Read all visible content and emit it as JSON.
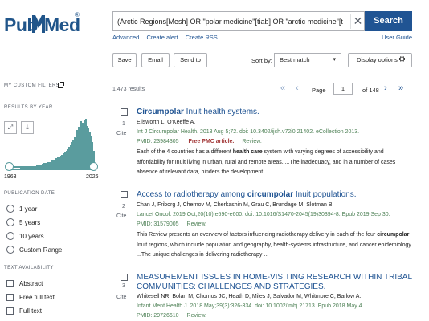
{
  "header": {
    "logo_pub": "Pub",
    "logo_med": "Med",
    "logo_reg": "®",
    "search_value": "(Arctic Regions[Mesh] OR \"polar medicine\"[tiab] OR \"arctic medicine\"[tiab] O",
    "search_button": "Search",
    "clear_symbol": "✕",
    "links": [
      "Advanced",
      "Create alert",
      "Create RSS"
    ],
    "user_guide": "User Guide"
  },
  "toolbar": {
    "save": "Save",
    "email": "Email",
    "send_to": "Send to",
    "sort_label": "Sort by:",
    "sort_value": "Best match",
    "display_options": "Display options"
  },
  "sidebar": {
    "custom_filters": "MY CUSTOM FILTERS",
    "results_by_year": "RESULTS BY YEAR",
    "year_start": "1963",
    "year_end": "2026",
    "publication_date": "PUBLICATION DATE",
    "date_options": [
      "1 year",
      "5 years",
      "10 years",
      "Custom Range"
    ],
    "text_availability": "TEXT AVAILABILITY",
    "text_options": [
      "Abstract",
      "Free full text",
      "Full text"
    ],
    "histogram": [
      1,
      1,
      1,
      1,
      2,
      2,
      2,
      2,
      3,
      3,
      3,
      3,
      4,
      4,
      4,
      5,
      5,
      5,
      6,
      6,
      7,
      7,
      8,
      8,
      9,
      10,
      10,
      11,
      12,
      12,
      13,
      14,
      15,
      16,
      17,
      18,
      19,
      20,
      22,
      24,
      26,
      28,
      30,
      33,
      36,
      40,
      44,
      48,
      52,
      58,
      62,
      66,
      70,
      68,
      72,
      74,
      64,
      60,
      56,
      50,
      40,
      28
    ]
  },
  "results": {
    "count": "1,473 results",
    "page_label": "Page",
    "page_value": "1",
    "page_of": "of 148",
    "items": [
      {
        "num": "1",
        "cite": "Cite",
        "title_bold": "Circumpolar",
        "title_rest": " Inuit health systems.",
        "authors": "Ellsworth L, O'Keeffe A.",
        "journal": "Int J Circumpolar Health. 2013 Aug 5;72. doi: 10.3402/ijch.v72i0.21402. eCollection 2013.",
        "pmid": "PMID: 23984305",
        "free": "Free PMC article.",
        "review": "Review.",
        "snippet_a": "Each of the 4 countries has a different ",
        "snippet_bold": "health care",
        "snippet_b": " system with varying degrees of accessibility and affordability for Inuit living in urban, rural and remote areas. ...The inadequacy, and in a number of cases absence of relevant data, hinders the development ..."
      },
      {
        "num": "2",
        "cite": "Cite",
        "title_pre": "Access to radiotherapy among ",
        "title_bold": "circumpolar",
        "title_rest": " Inuit populations.",
        "authors": "Chan J, Friborg J, Chernov M, Cherkashin M, Grau C, Brundage M, Slotman B.",
        "journal": "Lancet Oncol. 2019 Oct;20(10):e590-e600. doi: 10.1016/S1470-2045(19)30394-8. Epub 2019 Sep 30.",
        "pmid": "PMID: 31579005",
        "review": "Review.",
        "snippet_a": "This Review presents an overview of factors influencing radiotherapy delivery in each of the four ",
        "snippet_bold": "circumpolar",
        "snippet_b": " Inuit regions, which include population and geography, health-systems infrastructure, and cancer epidemiology. ...The unique challenges in delivering radiotherapy ..."
      },
      {
        "num": "3",
        "cite": "Cite",
        "title_rest": "MEASUREMENT ISSUES IN HOME-VISITING RESEARCH WITHIN TRIBAL COMMUNITIES: CHALLENGES AND STRATEGIES.",
        "authors": "Whitesell NR, Bolan M, Chomos JC, Heath D, Miles J, Salvador M, Whitmore C, Barlow A.",
        "journal": "Infant Ment Health J. 2018 May;39(3):326-334. doi: 10.1002/imhj.21713. Epub 2018 May 4.",
        "pmid": "PMID: 29726610",
        "review": "Review."
      }
    ]
  },
  "colors": {
    "brand": "#20558a",
    "link": "#205493",
    "journal_green": "#4d8055",
    "free_red": "#a23737",
    "histogram": "#5a9c9e"
  }
}
